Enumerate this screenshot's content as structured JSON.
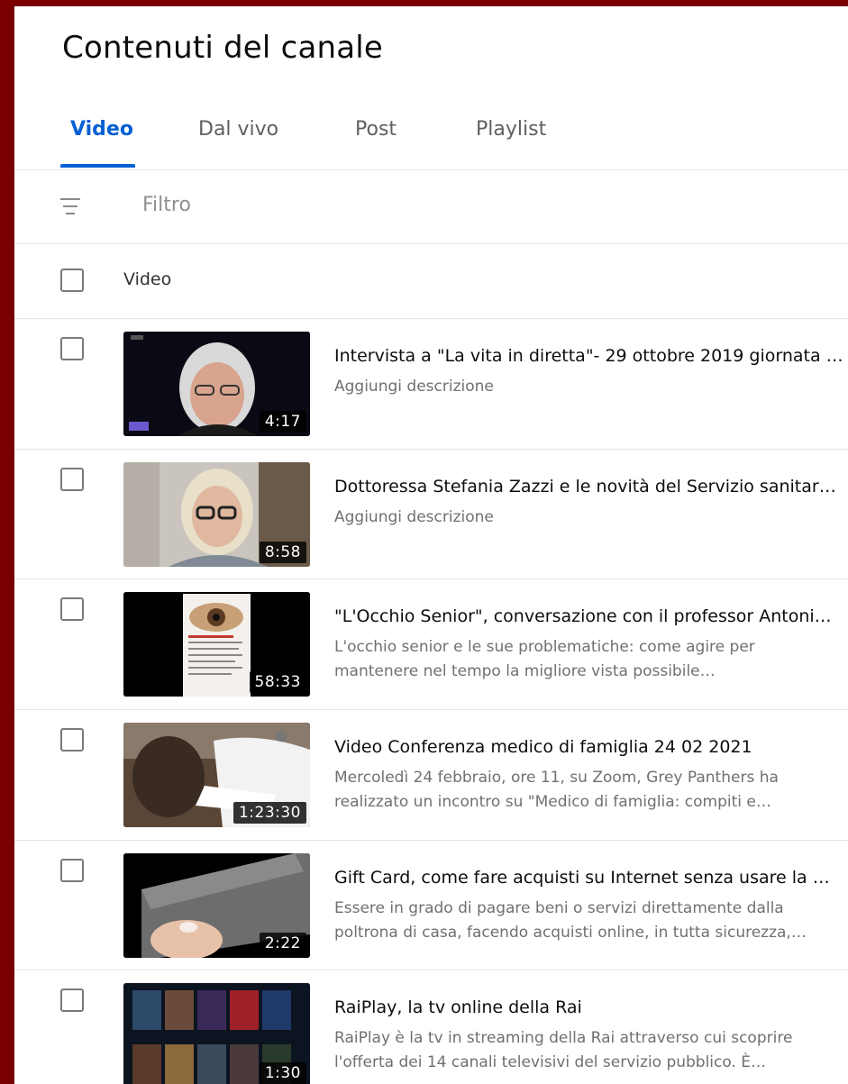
{
  "page": {
    "title": "Contenuti del canale"
  },
  "tabs": [
    {
      "label": "Video",
      "active": true
    },
    {
      "label": "Dal vivo",
      "active": false
    },
    {
      "label": "Post",
      "active": false
    },
    {
      "label": "Playlist",
      "active": false
    }
  ],
  "filter": {
    "placeholder": "Filtro",
    "icon": "filter-icon"
  },
  "table": {
    "header_label": "Video"
  },
  "videos": [
    {
      "title": "Intervista a \"La vita in diretta\"- 29 ottobre 2019 giornata …",
      "description": "Aggiungi descrizione",
      "duration": "4:17"
    },
    {
      "title": "Dottoressa Stefania Zazzi e le novità del Servizio sanitar…",
      "description": "Aggiungi descrizione",
      "duration": "8:58"
    },
    {
      "title": "\"L'Occhio Senior\", conversazione con il professor Antoni…",
      "description": "L'occhio senior e le sue problematiche: come agire per mantenere nel tempo la migliore vista possibile…",
      "duration": "58:33"
    },
    {
      "title": "Video Conferenza medico di famiglia 24 02 2021",
      "description": "Mercoledì 24 febbraio, ore 11, su Zoom, Grey Panthers ha realizzato un incontro su \"Medico di famiglia: compiti e…",
      "duration": "1:23:30"
    },
    {
      "title": "Gift Card, come fare acquisti su Internet senza usare la …",
      "description": "Essere in grado di pagare beni o servizi direttamente dalla poltrona di casa, facendo acquisti online, in tutta sicurezza,…",
      "duration": "2:22"
    },
    {
      "title": "RaiPlay, la tv online della Rai",
      "description": "RaiPlay è la tv in streaming della Rai attraverso cui scoprire l'offerta dei 14 canali televisivi del servizio pubblico. È…",
      "duration": "1:30"
    }
  ],
  "colors": {
    "accent": "#065fd4",
    "frame": "#7a0000"
  }
}
